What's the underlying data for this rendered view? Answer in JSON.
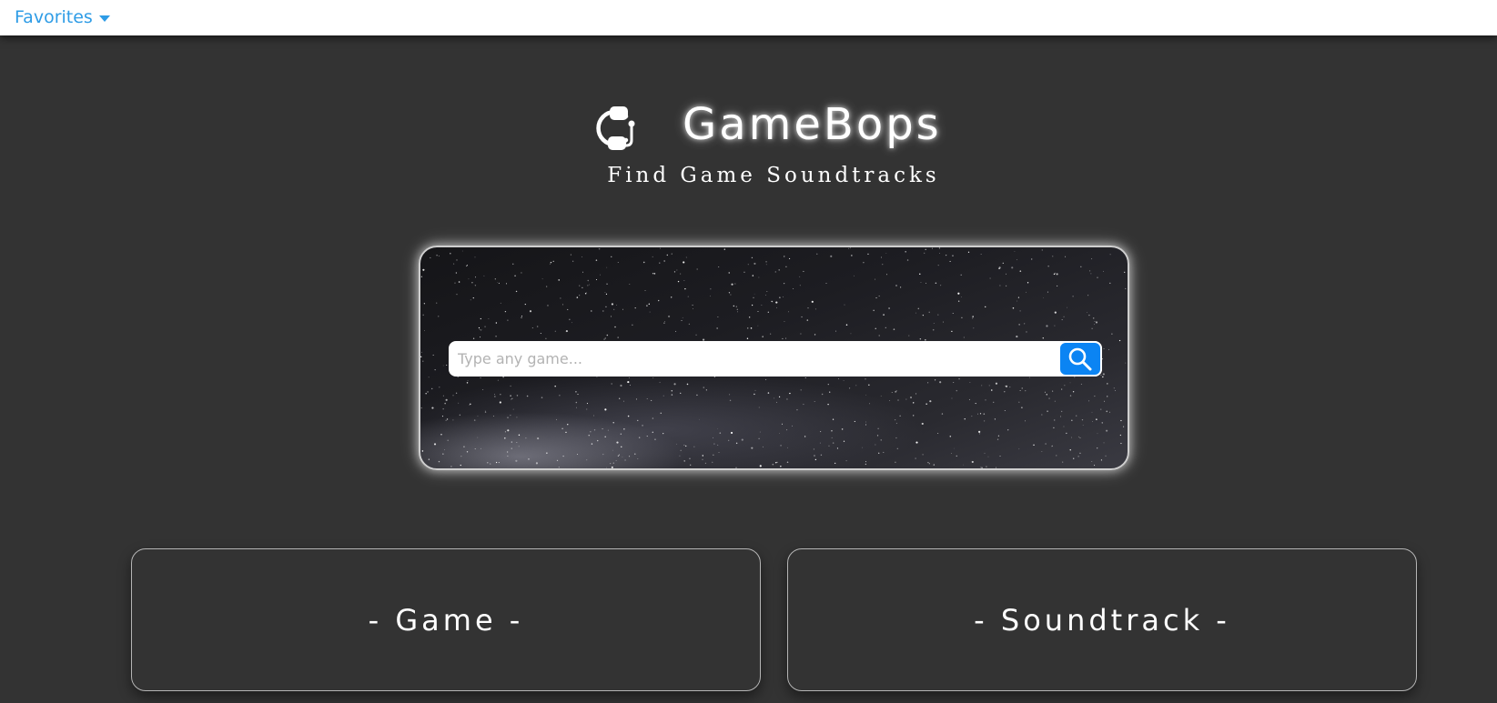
{
  "nav": {
    "favorites_label": "Favorites",
    "favorites_icon": "caret-down-icon",
    "accent_color": "#2e9ce6"
  },
  "hero": {
    "logo_icon": "headset-icon",
    "title": "GameBops",
    "tagline": "Find Game Soundtracks"
  },
  "search": {
    "placeholder": "Type any game...",
    "value": "",
    "button_icon": "search-icon",
    "button_color": "#0b84f3"
  },
  "categories": [
    {
      "label": "- Game -"
    },
    {
      "label": "- Soundtrack -"
    }
  ],
  "theme": {
    "background": "#333333",
    "text": "#ffffff"
  }
}
